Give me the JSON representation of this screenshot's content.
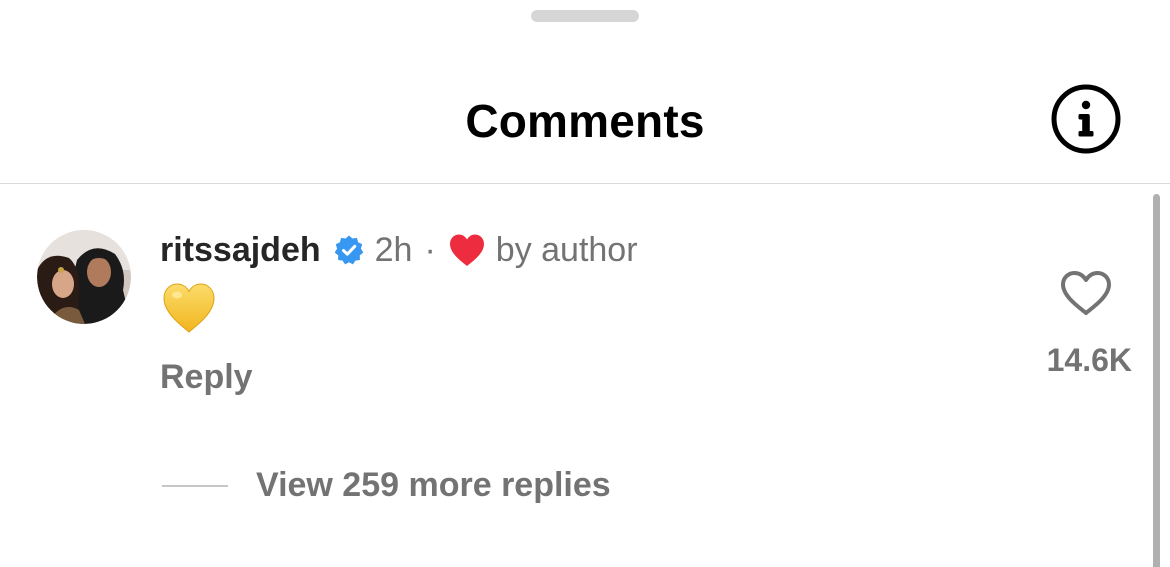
{
  "header": {
    "title": "Comments",
    "info_icon": "info-circle-icon"
  },
  "comment": {
    "username": "ritssajdeh",
    "verified_icon": "verified-badge-icon",
    "time": "2h",
    "separator": "·",
    "liked_by_author_icon": "red-heart-icon",
    "liked_by_label": "by author",
    "body_emoji": "💛",
    "reply_label": "Reply",
    "like_icon": "heart-outline-icon",
    "like_count": "14.6K"
  },
  "replies": {
    "view_more_label": "View 259 more replies"
  },
  "colors": {
    "text_primary": "#000000",
    "text_secondary": "#737373",
    "verified_blue": "#3897f0",
    "heart_red": "#ed2d3f",
    "yellow_heart": "#f6c83b",
    "divider": "#dbdbdb"
  }
}
